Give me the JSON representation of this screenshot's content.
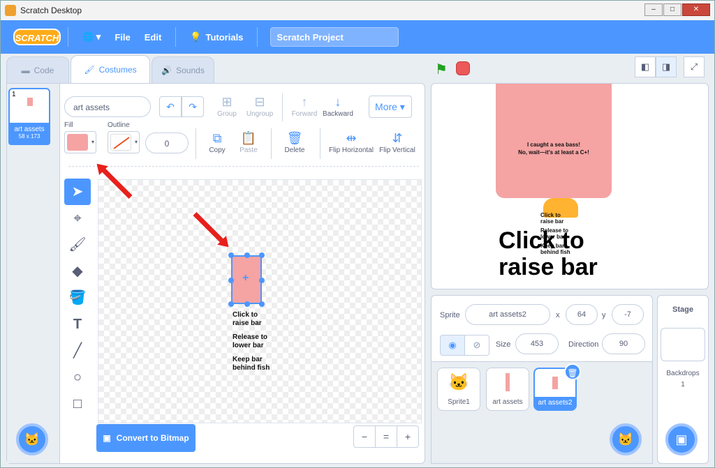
{
  "window": {
    "title": "Scratch Desktop",
    "minimize": "–",
    "maximize": "□",
    "close": "✕"
  },
  "menu": {
    "logo": "SCRATCH",
    "globe": "🌐 ▾",
    "file": "File",
    "edit": "Edit",
    "tutorials": "Tutorials",
    "project_title": "Scratch Project"
  },
  "tabs": {
    "code": "Code",
    "costumes": "Costumes",
    "sounds": "Sounds"
  },
  "costume_list": [
    {
      "number": "1",
      "name": "art assets",
      "size": "58 x 173"
    }
  ],
  "paint": {
    "costume_name": "art assets",
    "undo": "↶",
    "redo": "↷",
    "group": "Group",
    "ungroup": "Ungroup",
    "forward": "Forward",
    "backward": "Backward",
    "more": "More ▾",
    "fill_label": "Fill",
    "outline_label": "Outline",
    "outline_width": "0",
    "copy": "Copy",
    "paste": "Paste",
    "delete": "Delete",
    "flip_horizontal": "Flip Horizontal",
    "flip_vertical": "Flip Vertical",
    "fill_color": "#f5a3a3",
    "canvas_text": {
      "line1": "Click to",
      "line2": "raise bar",
      "line3": "Release to",
      "line4": "lower bar",
      "line5": "Keep bar",
      "line6": "behind fish"
    },
    "convert": "Convert to Bitmap",
    "zoom_out": "−",
    "zoom_reset": "=",
    "zoom_in": "+"
  },
  "stage": {
    "sign_line1": "I caught a sea bass!",
    "sign_line2": "No, wait—it's at least a C+!",
    "big_line1": "Click to",
    "big_line2": "raise bar",
    "small_text": [
      "Click to",
      "raise bar",
      "Release to",
      "lower bar",
      "Keep bar",
      "behind fish"
    ]
  },
  "sprite_info": {
    "sprite_label": "Sprite",
    "sprite_name": "art assets2",
    "x_label": "x",
    "x": "64",
    "y_label": "y",
    "y": "-7",
    "show_label": "Show",
    "size_label": "Size",
    "size": "453",
    "direction_label": "Direction",
    "direction": "90"
  },
  "sprites": [
    {
      "name": "Sprite1"
    },
    {
      "name": "art assets"
    },
    {
      "name": "art assets2"
    }
  ],
  "stage_panel": {
    "title": "Stage",
    "backdrops_label": "Backdrops",
    "backdrops_count": "1"
  }
}
